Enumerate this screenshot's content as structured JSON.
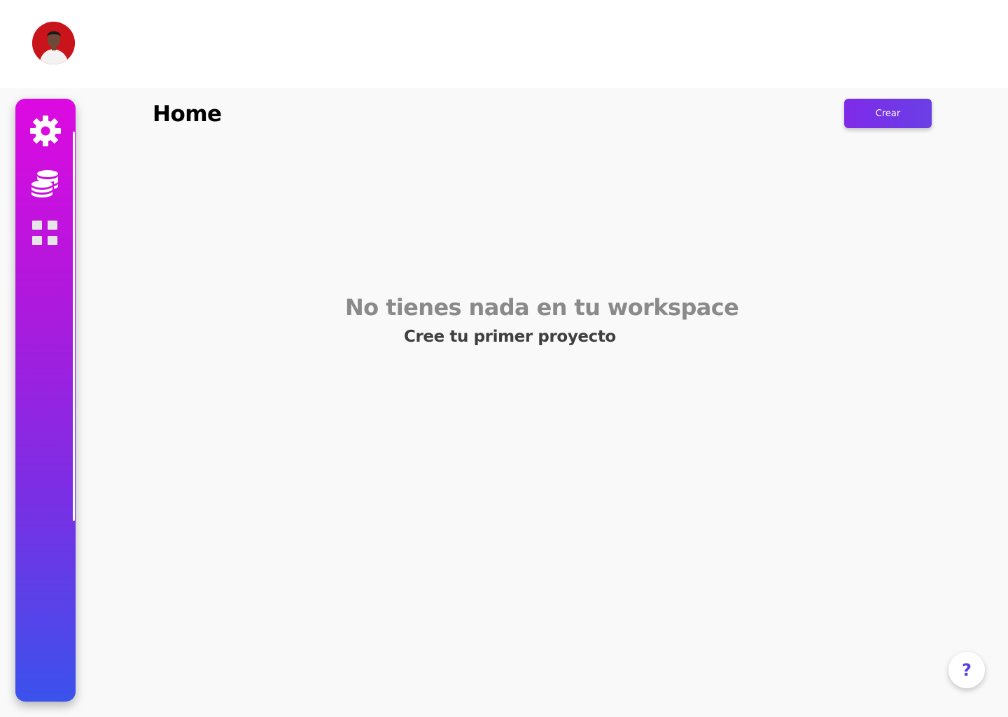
{
  "header": {
    "avatar_alt": "user-avatar"
  },
  "sidebar": {
    "items": [
      {
        "icon": "gear-icon"
      },
      {
        "icon": "coins-stack-icon"
      },
      {
        "icon": "grid-icon"
      }
    ]
  },
  "main": {
    "title": "Home",
    "create_label": "Crear",
    "empty_title": "No tienes nada en tu workspace",
    "empty_subtitle": "Cree tu primer proyecto"
  },
  "help": {
    "label": "?"
  },
  "colors": {
    "accent": "#7f2ae8",
    "sidebar_top": "#dd0ae0",
    "sidebar_bottom": "#3b52ec",
    "background": "#f9f9f9"
  }
}
